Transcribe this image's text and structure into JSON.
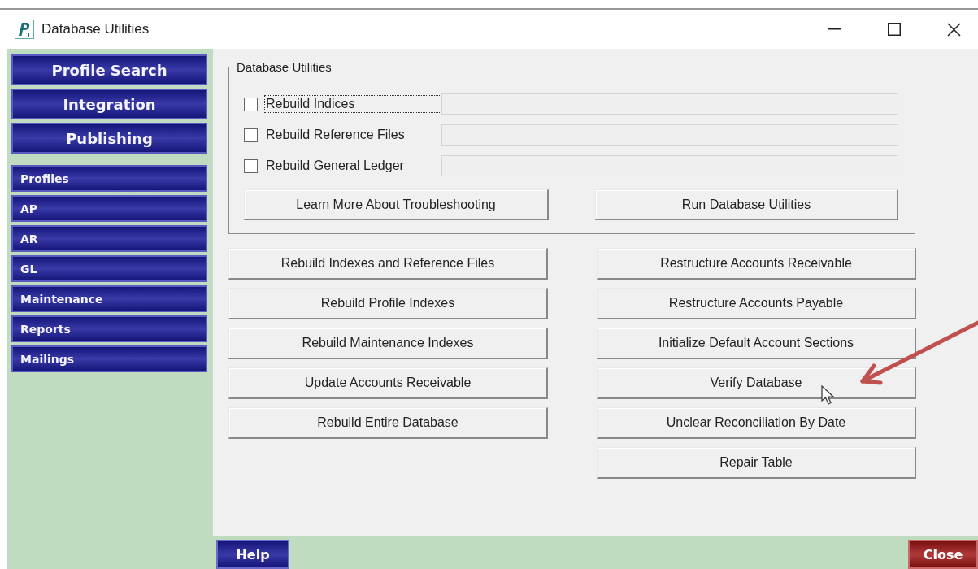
{
  "window": {
    "title": "Database Utilities"
  },
  "sidebar": {
    "main_items": [
      {
        "label": "Profile Search"
      },
      {
        "label": "Integration"
      },
      {
        "label": "Publishing"
      }
    ],
    "items": [
      {
        "label": "Profiles"
      },
      {
        "label": "AP"
      },
      {
        "label": "AR"
      },
      {
        "label": "GL"
      },
      {
        "label": "Maintenance"
      },
      {
        "label": "Reports"
      },
      {
        "label": "Mailings"
      }
    ]
  },
  "group": {
    "title": "Database Utilities",
    "options": [
      {
        "label": "Rebuild Indices",
        "checked": false,
        "focused": true
      },
      {
        "label": "Rebuild Reference Files",
        "checked": false,
        "focused": false
      },
      {
        "label": "Rebuild General Ledger",
        "checked": false,
        "focused": false
      }
    ],
    "buttons": [
      "Learn More About Troubleshooting",
      "Run Database Utilities"
    ]
  },
  "left_buttons": [
    "Rebuild Indexes and Reference Files",
    "Rebuild Profile Indexes",
    "Rebuild Maintenance Indexes",
    "Update Accounts Receivable",
    "Rebuild Entire Database"
  ],
  "right_buttons": [
    "Restructure Accounts Receivable",
    "Restructure Accounts Payable",
    "Initialize Default Account Sections",
    "Verify Database",
    "Unclear Reconciliation By Date",
    "Repair Table"
  ],
  "footer": {
    "help": "Help",
    "close": "Close"
  }
}
